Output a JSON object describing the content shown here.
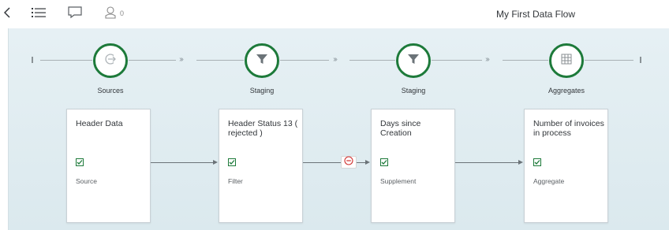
{
  "toolbar": {
    "back_icon": "chevron-left-icon",
    "list_icon": "list-icon",
    "comment_icon": "comment-icon",
    "user_icon": "user-icon",
    "user_count": "0",
    "title": "My First Data Flow"
  },
  "colors": {
    "accent_green": "#1d7a3a",
    "canvas_bg": "#dde9ee",
    "remove_red": "#d0302f"
  },
  "stages": [
    {
      "label": "Sources",
      "icon": "arrow-right-circle-icon"
    },
    {
      "label": "Staging",
      "icon": "filter-icon"
    },
    {
      "label": "Staging",
      "icon": "filter-icon"
    },
    {
      "label": "Aggregates",
      "icon": "grid-icon"
    }
  ],
  "cards": [
    {
      "title": "Header Data",
      "type": "Source",
      "checked": true
    },
    {
      "title": "Header Status 13 ( rejected )",
      "type": "Filter",
      "checked": true
    },
    {
      "title": "Days since Creation",
      "type": "Supplement",
      "checked": true
    },
    {
      "title": "Number of invoices in process",
      "type": "Aggregate",
      "checked": true
    }
  ],
  "connector_icon": "remove-circle-icon"
}
